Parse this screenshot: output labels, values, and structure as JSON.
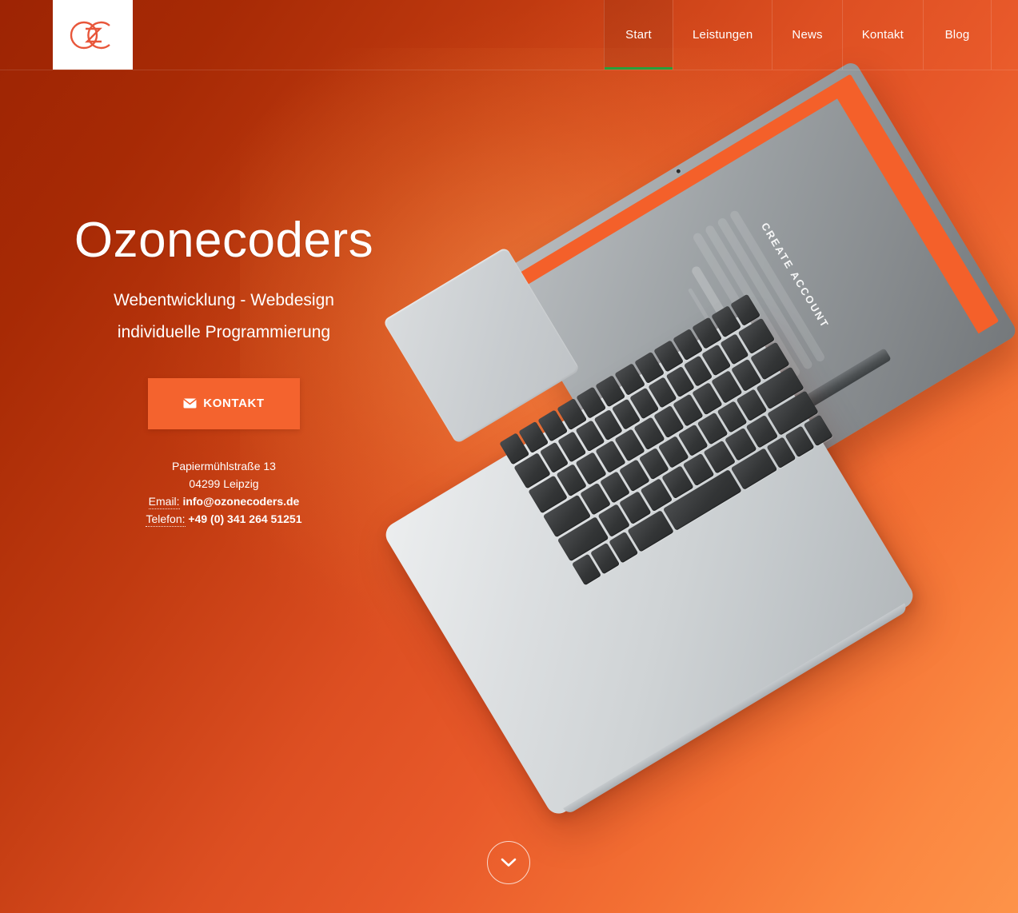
{
  "header": {
    "logo_alt": "Ozonecoders Logo OZC",
    "nav": [
      {
        "label": "Start",
        "active": true
      },
      {
        "label": "Leistungen",
        "active": false
      },
      {
        "label": "News",
        "active": false
      },
      {
        "label": "Kontakt",
        "active": false
      },
      {
        "label": "Blog",
        "active": false
      }
    ]
  },
  "hero": {
    "title": "Ozonecoders",
    "subtitle_line1": "Webentwicklung - Webdesign",
    "subtitle_line2": "individuelle Programmierung",
    "cta_label": "KONTAKT",
    "contact": {
      "street": "Papiermühlstraße 13",
      "city": "04299 Leipzig",
      "email_label": "Email:",
      "email_value": "info@ozonecoders.de",
      "phone_label": "Telefon:",
      "phone_value": "+49 (0) 341 264 51251"
    }
  },
  "laptop_screen": {
    "heading": "CREATE ACCOUNT"
  },
  "colors": {
    "accent_orange": "#f4632e",
    "bg_dark_red": "#9d2404",
    "bg_light_orange": "#fd9349",
    "active_underline_green": "#27a03c",
    "logo_orange": "#e8563a",
    "text_white": "#ffffff"
  }
}
